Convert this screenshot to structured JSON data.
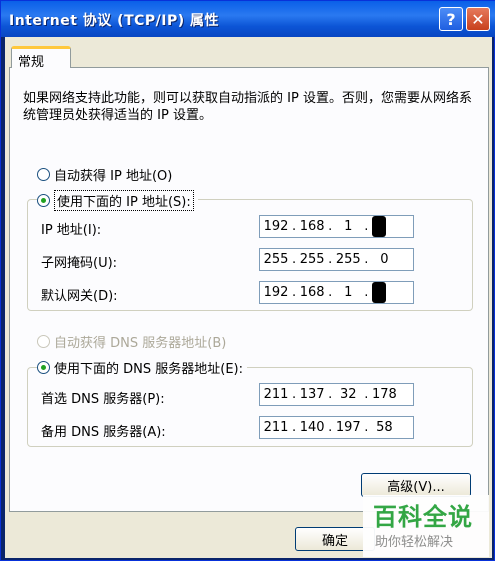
{
  "window": {
    "title": "Internet 协议 (TCP/IP) 属性",
    "help_glyph": "?",
    "close_glyph": "✕"
  },
  "tabs": [
    {
      "label": "常规",
      "active": true
    }
  ],
  "description": "如果网络支持此功能，则可以获取自动指派的 IP 设置。否则，您需要从网络系统管理员处获得适当的 IP 设置。",
  "ip_section": {
    "auto_label": "自动获得 IP 地址(O)",
    "manual_label": "使用下面的 IP 地址(S):",
    "selected": "manual",
    "fields": [
      {
        "label": "IP 地址(I):",
        "octets": [
          "192",
          "168",
          "1",
          ""
        ],
        "last_redacted": true
      },
      {
        "label": "子网掩码(U):",
        "octets": [
          "255",
          "255",
          "255",
          "0"
        ],
        "last_redacted": false
      },
      {
        "label": "默认网关(D):",
        "octets": [
          "192",
          "168",
          "1",
          ""
        ],
        "last_redacted": true
      }
    ]
  },
  "dns_section": {
    "auto_label": "自动获得 DNS 服务器地址(B)",
    "manual_label": "使用下面的 DNS 服务器地址(E):",
    "selected": "manual",
    "fields": [
      {
        "label": "首选 DNS 服务器(P):",
        "octets": [
          "211",
          "137",
          "32",
          "178"
        ]
      },
      {
        "label": "备用 DNS 服务器(A):",
        "octets": [
          "211",
          "140",
          "197",
          "58"
        ]
      }
    ]
  },
  "buttons": {
    "advanced": "高级(V)...",
    "ok": "确定"
  },
  "watermark": {
    "title": "百科全说",
    "subtitle": "助你轻松解决"
  },
  "colors": {
    "title_bar": "#0a5fe8",
    "dialog_bg": "#ece9d8",
    "tab_accent": "#ffc83c",
    "radio_dot": "#21a121",
    "watermark_green": "#2aa33d"
  }
}
